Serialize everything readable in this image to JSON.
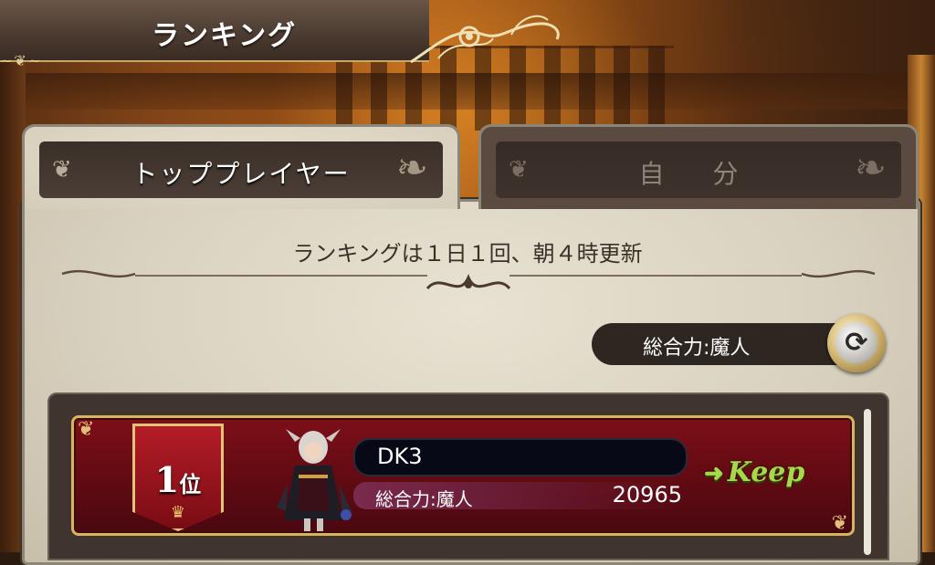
{
  "header": {
    "title": "ランキング"
  },
  "tabs": [
    {
      "label": "トッププレイヤー",
      "active": true
    },
    {
      "label": "自 分",
      "active": false
    }
  ],
  "info_text": "ランキングは１日１回、朝４時更新",
  "sort": {
    "label": "総合力:魔人",
    "button_icon": "refresh-icon"
  },
  "ranking": [
    {
      "rank_number": "1",
      "rank_suffix": "位",
      "name": "DK3",
      "power_label": "総合力:魔人",
      "power_value": "20965",
      "action_label": "Keep",
      "action_icon": "arrow-right-icon"
    }
  ],
  "colors": {
    "row_bg": "#7d0f18",
    "row_border": "#d9b35f",
    "keep_green": "#a8d84a",
    "panel_bg": "#d9d2c0"
  }
}
